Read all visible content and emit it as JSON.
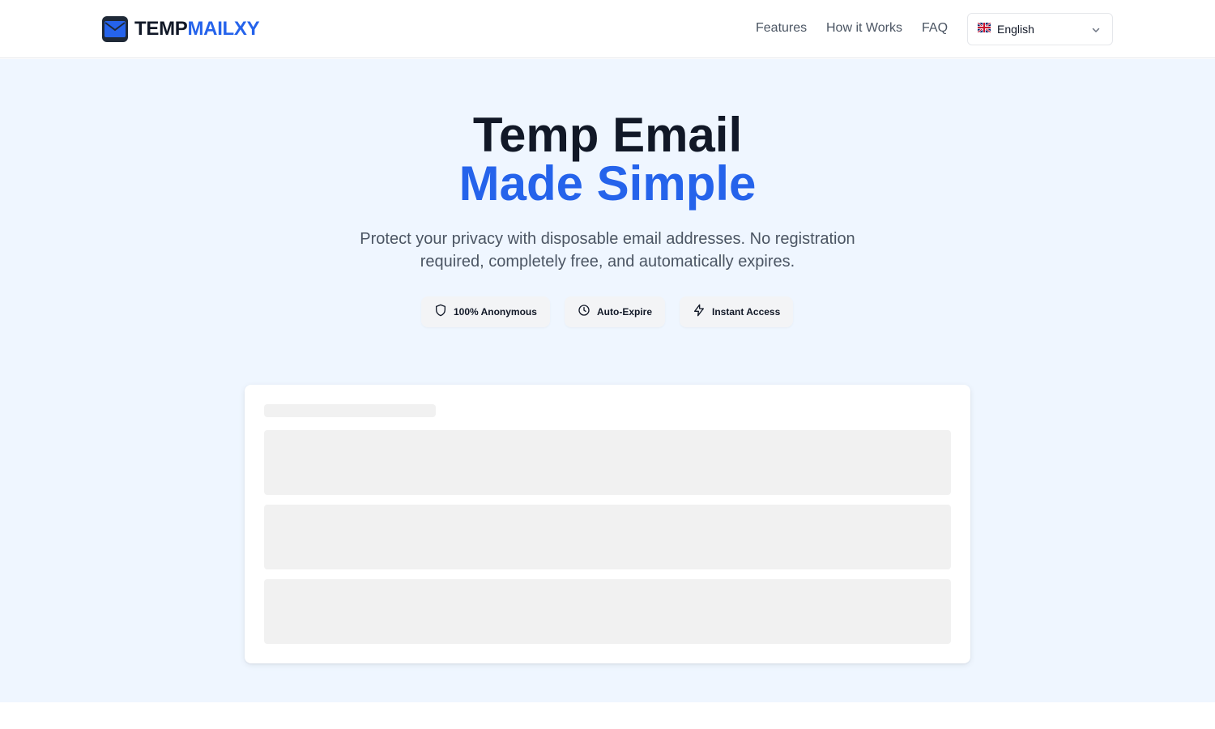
{
  "brand": {
    "part1": "TEMP",
    "part2": "MAILXY",
    "icon": "envelope-icon",
    "color": "#2563eb"
  },
  "nav": {
    "features": "Features",
    "how": "How it Works",
    "faq": "FAQ"
  },
  "language": {
    "flag": "uk-flag-icon",
    "selected": "English",
    "icon": "chevron-down-icon"
  },
  "hero": {
    "title_line1": "Temp Email",
    "title_line2": "Made Simple",
    "subtitle": "Protect your privacy with disposable email addresses. No registration required, completely free, and automatically expires.",
    "badges": [
      {
        "icon": "shield-icon",
        "label": "100% Anonymous"
      },
      {
        "icon": "clock-icon",
        "label": "Auto-Expire"
      },
      {
        "icon": "lightning-icon",
        "label": "Instant Access"
      }
    ]
  },
  "colors": {
    "accent": "#2563eb",
    "hero_bg": "#eff6ff",
    "skeleton": "#f1f1f1"
  }
}
